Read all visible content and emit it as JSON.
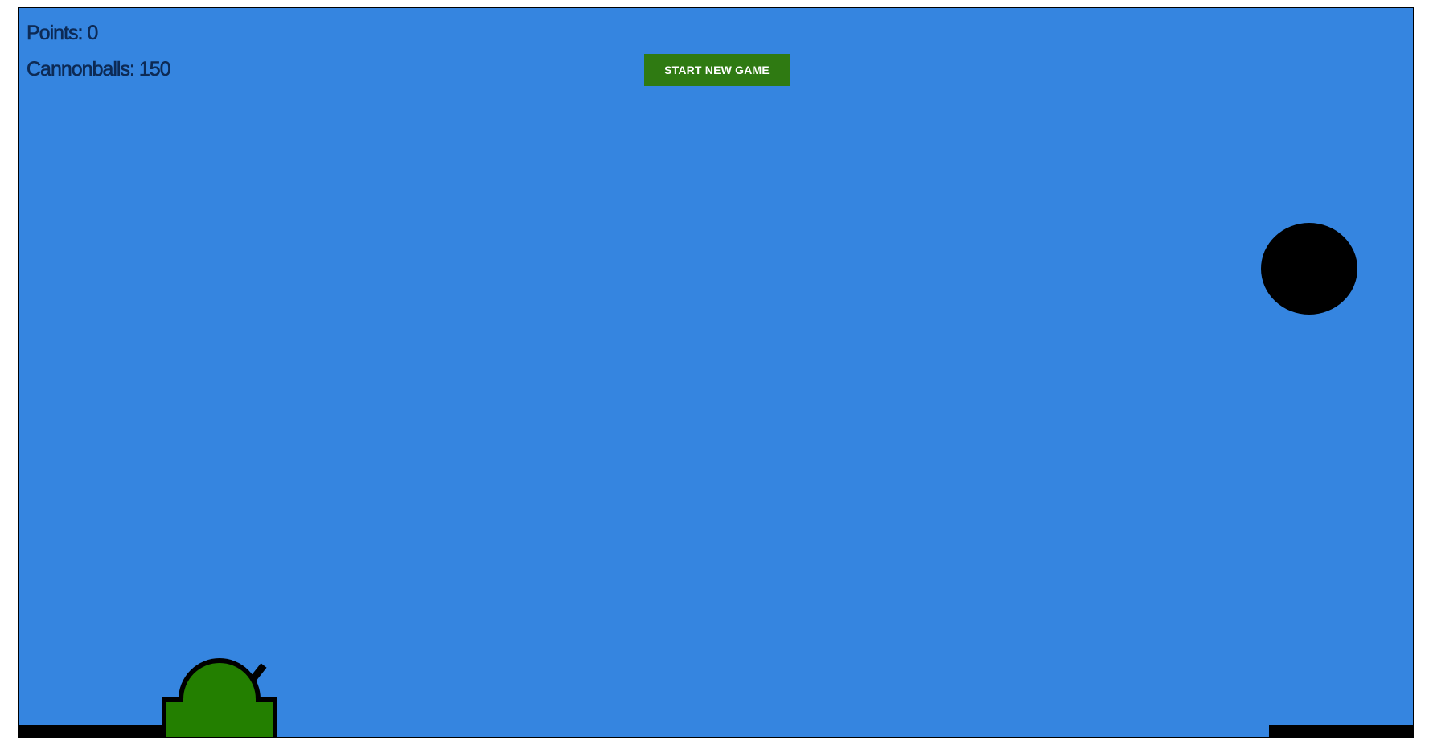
{
  "hud": {
    "points_label": "Points: 0",
    "points_value": 0,
    "cannonballs_label": "Cannonballs: 150",
    "cannonballs_value": 150
  },
  "controls": {
    "start_button_label": "START NEW GAME"
  },
  "colors": {
    "sky": "#3585e0",
    "button": "#2f7a12",
    "tank_body": "#237f00",
    "outline": "#000000",
    "ground_stripe": "#9b2226",
    "ground_block": "#000000",
    "target": "#000000"
  },
  "icons": {
    "player": "cannon-tank-icon",
    "target": "black-ball-target-icon"
  }
}
